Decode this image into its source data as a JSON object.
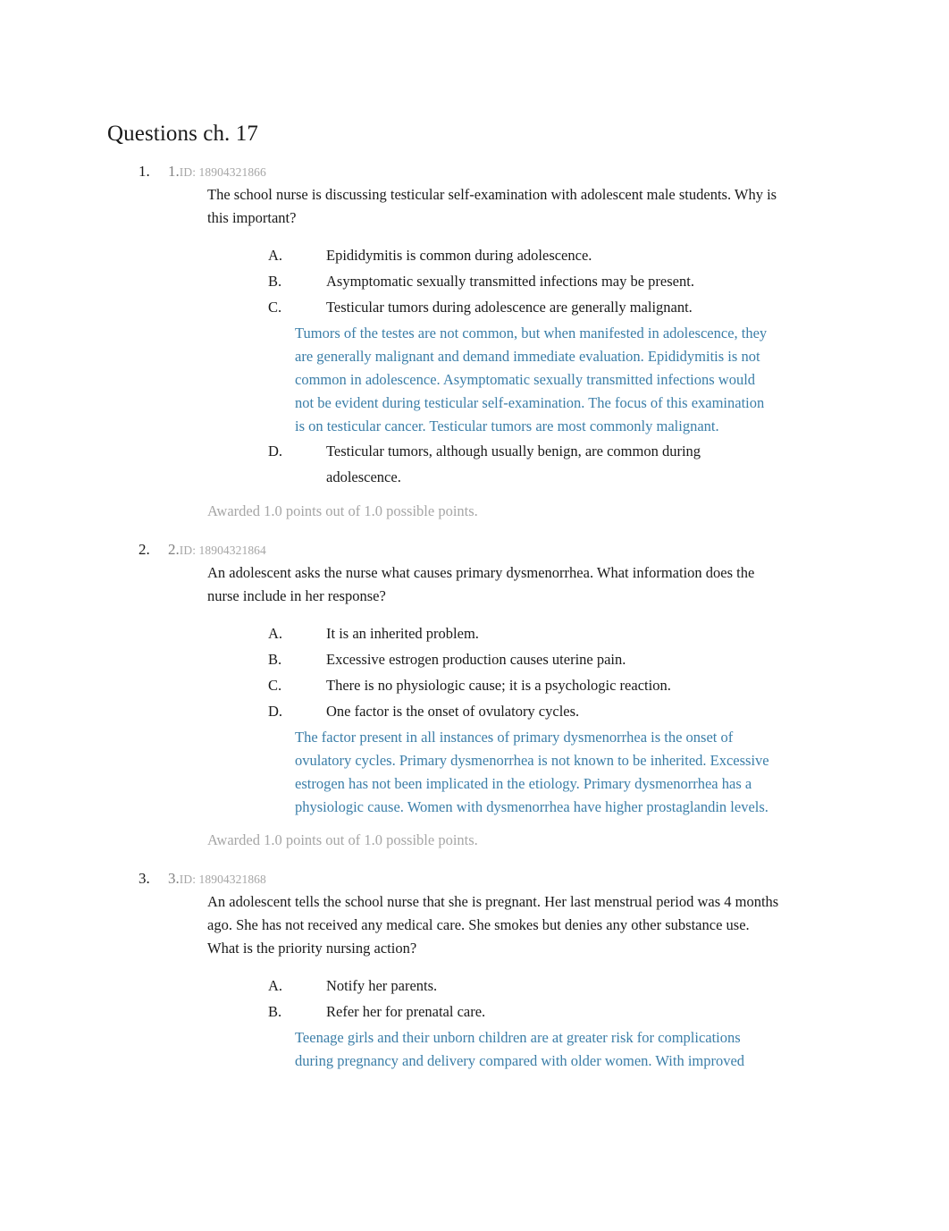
{
  "document": {
    "title": "Questions ch. 17"
  },
  "questions": [
    {
      "outer_number": "1.",
      "inner_number": "1.",
      "id_label": "ID: 18904321866",
      "stem": "The school nurse is discussing testicular self-examination with adolescent male students. Why is this important?",
      "options": [
        {
          "letter": "A.",
          "text": "Epididymitis is common during adolescence."
        },
        {
          "letter": "B.",
          "text": "Asymptomatic sexually transmitted infections may be present."
        },
        {
          "letter": "C.",
          "text": "Testicular tumors during adolescence are generally malignant.",
          "rationale": "Tumors of the testes are not common, but when manifested in adolescence, they are generally malignant and demand immediate evaluation. Epididymitis is not common in adolescence. Asymptomatic sexually transmitted infections would not be evident during testicular self-examination. The focus of this examination is on testicular cancer. Testicular tumors are most commonly malignant."
        },
        {
          "letter": "D.",
          "text": "Testicular tumors, although usually benign, are common during adolescence."
        }
      ],
      "awarded": "Awarded 1.0 points out of 1.0 possible points."
    },
    {
      "outer_number": "2.",
      "inner_number": "2.",
      "id_label": "ID: 18904321864",
      "stem": "An adolescent asks the nurse what causes primary dysmenorrhea. What information does the nurse include in her response?",
      "options": [
        {
          "letter": "A.",
          "text": "It is an inherited problem."
        },
        {
          "letter": "B.",
          "text": "Excessive estrogen production causes uterine pain."
        },
        {
          "letter": "C.",
          "text": "There is no physiologic cause; it is a psychologic reaction."
        },
        {
          "letter": "D.",
          "text": "One factor is the onset of ovulatory cycles.",
          "rationale": "The factor present in all instances of primary dysmenorrhea is the onset of ovulatory cycles. Primary dysmenorrhea is not known to be inherited. Excessive estrogen has not been implicated in the etiology. Primary dysmenorrhea has a physiologic cause. Women with dysmenorrhea have higher prostaglandin levels."
        }
      ],
      "awarded": "Awarded 1.0 points out of 1.0 possible points."
    },
    {
      "outer_number": "3.",
      "inner_number": "3.",
      "id_label": "ID: 18904321868",
      "stem": "An adolescent tells the school nurse that she is pregnant. Her last menstrual period was 4 months ago. She has not received any medical care. She smokes but denies any other substance use. What is the priority nursing action?",
      "options": [
        {
          "letter": "A.",
          "text": "Notify her parents."
        },
        {
          "letter": "B.",
          "text": "Refer her for prenatal care.",
          "rationale": "Teenage girls and their unborn children are at greater risk for complications during pregnancy and delivery compared with older women. With improved"
        }
      ],
      "awarded": null
    }
  ]
}
